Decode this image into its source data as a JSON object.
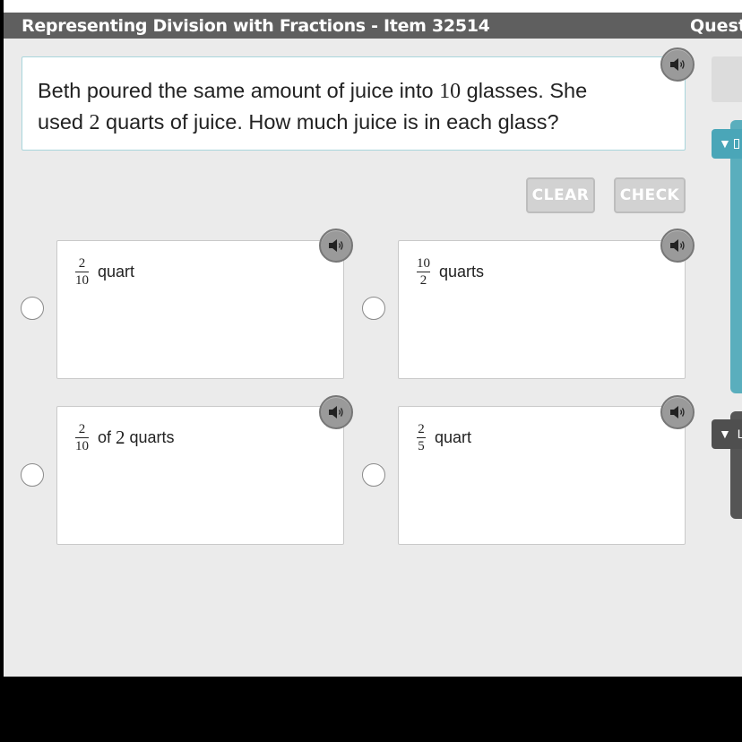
{
  "header": {
    "title": "Representing Division with Fractions - Item 32514",
    "right_text": "Questi"
  },
  "question": {
    "line1_part1": "Beth poured the same amount of juice into ",
    "line1_num": "10",
    "line1_part2": " glasses. She",
    "line2_part1": "used ",
    "line2_num": "2",
    "line2_part2": " quarts of juice. How much juice is in each glass?"
  },
  "buttons": {
    "clear": "CLEAR",
    "check": "CHECK"
  },
  "choices": [
    {
      "numerator": "2",
      "denominator": "10",
      "prefix": "",
      "text": "quart"
    },
    {
      "numerator": "10",
      "denominator": "2",
      "prefix": "",
      "text": "quarts"
    },
    {
      "numerator": "2",
      "denominator": "10",
      "prefix": "of",
      "num_text": "2",
      "text": "quarts"
    },
    {
      "numerator": "2",
      "denominator": "5",
      "prefix": "",
      "text": "quart"
    }
  ],
  "side_tabs": {
    "teal_arrow": "▼",
    "dark_arrow": "▼",
    "dark_label": "L"
  },
  "icons": {
    "audio": "speaker-icon",
    "collapse": "triangle-down-icon"
  },
  "colors": {
    "title_bar": "#5f5f5f",
    "accent_teal": "#5aaebd",
    "question_border": "#a9d6dc",
    "button_disabled": "#d2d2d2"
  }
}
